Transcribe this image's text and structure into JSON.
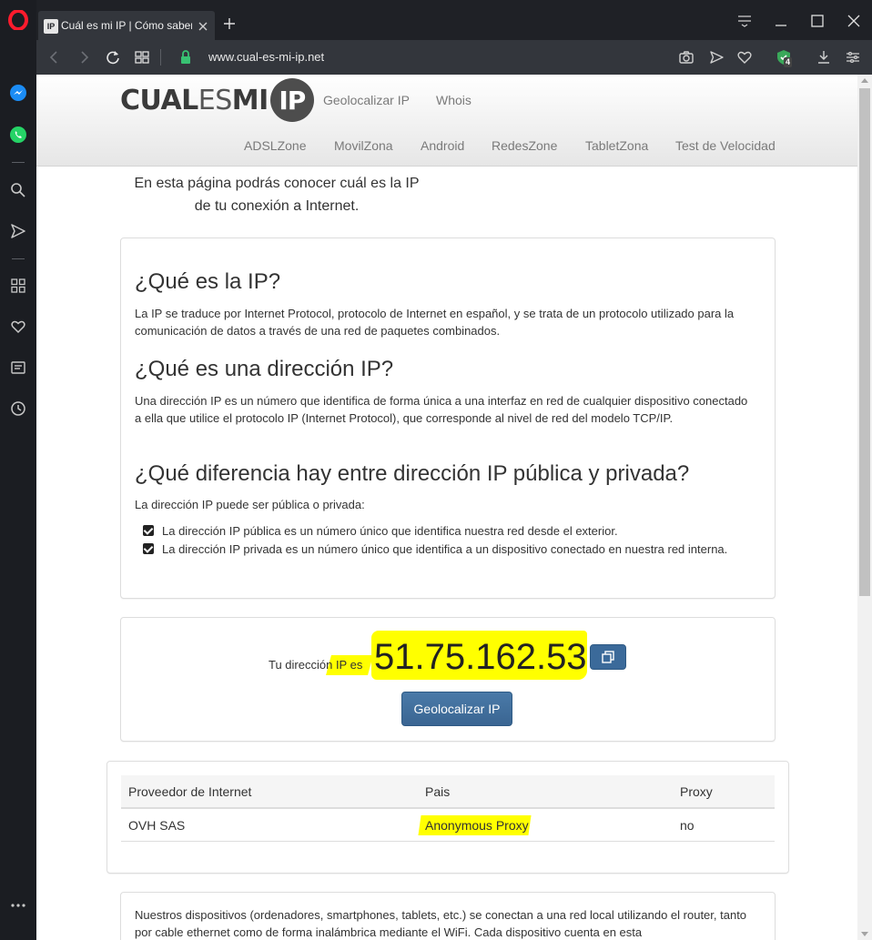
{
  "browser": {
    "tab_title": "Cuál es mi IP | Cómo saber",
    "favicon_text": "IP",
    "url": "www.cual-es-mi-ip.net",
    "vpn_badge_count": "4"
  },
  "site": {
    "logo_part1": "CUAL",
    "logo_part2": "ES",
    "logo_part3": "MI",
    "logo_badge": "IP",
    "nav_top": [
      "Geolocalizar IP",
      "Whois"
    ],
    "nav_bottom": [
      "ADSLZone",
      "MovilZona",
      "Android",
      "RedesZone",
      "TabletZona",
      "Test de Velocidad"
    ]
  },
  "intro_text": "En esta página podrás conocer cuál es la IP de tu conexión a Internet.",
  "info": {
    "h1": "¿Qué es la IP?",
    "p1": "La IP se traduce por Internet Protocol, protocolo de Internet en español, y se trata de un protocolo utilizado para la comunicación de datos a través de una red de paquetes combinados.",
    "h2": "¿Qué es una dirección IP?",
    "p2": "Una dirección IP es un número que identifica de forma única a una interfaz en red de cualquier dispositivo conectado a ella que utilice el protocolo IP (Internet Protocol), que corresponde al nivel de red del modelo TCP/IP.",
    "h3": "¿Qué diferencia hay entre dirección IP pública y privada?",
    "p3": "La dirección IP puede ser pública o privada:",
    "checks": [
      "La dirección IP pública es un número único que identifica nuestra red desde el exterior.",
      "La dirección IP privada es un número único que identifica a un dispositivo conectado en nuestra red interna."
    ]
  },
  "ip_box": {
    "label": "Tu dirección IP es",
    "ip": "51.75.162.53",
    "geo_button": "Geolocalizar IP"
  },
  "isp_table": {
    "headers": [
      "Proveedor de Internet",
      "Pais",
      "Proxy"
    ],
    "row": [
      "OVH SAS",
      "Anonymous Proxy",
      "no"
    ]
  },
  "bottom_text": "Nuestros dispositivos (ordenadores, smartphones, tablets, etc.) se conectan a una red local utilizando el router, tanto por cable ethernet como de forma inalámbrica mediante el WiFi. Cada dispositivo cuenta en esta",
  "colors": {
    "highlight": "#ffff00",
    "button": "#3a6592",
    "opera_red": "#ff1b2d"
  }
}
